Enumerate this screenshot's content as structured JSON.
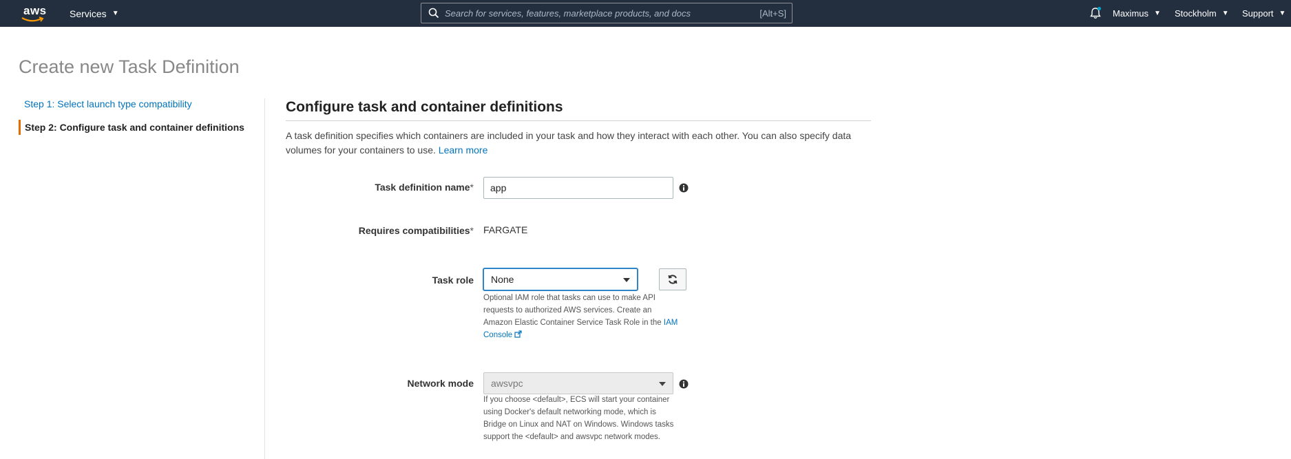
{
  "nav": {
    "logo_text": "aws",
    "services_label": "Services",
    "search_placeholder": "Search for services, features, marketplace products, and docs",
    "search_shortcut": "[Alt+S]",
    "user_label": "Maximus",
    "region_label": "Stockholm",
    "support_label": "Support",
    "notification_dot_color": "#00a1c9"
  },
  "page_title": "Create new Task Definition",
  "steps": {
    "step1": "Step 1: Select launch type compatibility",
    "step2": "Step 2: Configure task and container definitions"
  },
  "section": {
    "title": "Configure task and container definitions",
    "intro_text": "A task definition specifies which containers are included in your task and how they interact with each other. You can also specify data volumes for your containers to use.",
    "learn_more": "Learn more"
  },
  "form": {
    "task_name": {
      "label": "Task definition name",
      "required_mark": "*",
      "value": "app"
    },
    "compat": {
      "label": "Requires compatibilities",
      "required_mark": "*",
      "value": "FARGATE"
    },
    "task_role": {
      "label": "Task role",
      "selected": "None",
      "help_text": "Optional IAM role that tasks can use to make API requests to authorized AWS services. Create an Amazon Elastic Container Service Task Role in the",
      "help_link": "IAM Console"
    },
    "network_mode": {
      "label": "Network mode",
      "selected": "awsvpc",
      "help_text": "If you choose <default>, ECS will start your container using Docker's default networking mode, which is Bridge on Linux and NAT on Windows. Windows tasks support the <default> and awsvpc network modes."
    }
  },
  "colors": {
    "nav_bg": "#232f3e",
    "link": "#0073bb",
    "active_step_accent": "#e66b00"
  }
}
